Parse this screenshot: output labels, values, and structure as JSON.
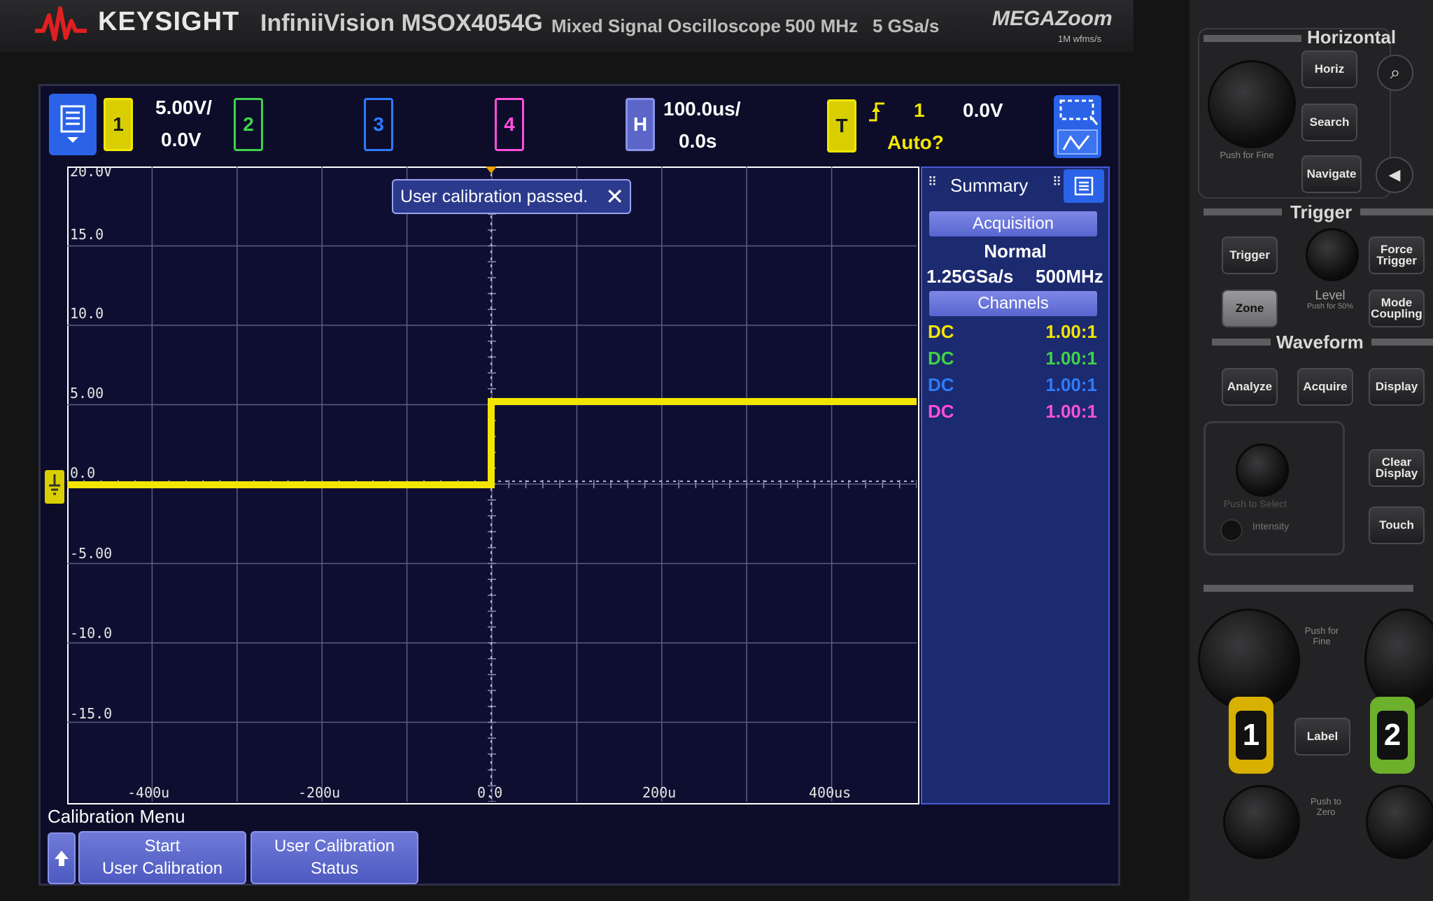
{
  "header": {
    "brand": "KEYSIGHT",
    "model": "InfiniiVision MSOX4054G",
    "description": "Mixed Signal Oscilloscope",
    "bandwidth": "500 MHz",
    "sample_rate": "5 GSa/s",
    "megazoom": "MEGAZoom",
    "megazoom_sub": "1M wfms/s"
  },
  "colors": {
    "ch1": "#f2e600",
    "ch2": "#3fd34a",
    "ch3": "#2d7bff",
    "ch4": "#ff4fdc",
    "screen_bg": "#0e0f30",
    "accent": "#4e5ac0"
  },
  "statusbar": {
    "ch1_label": "1",
    "ch1_scale": "5.00V/",
    "ch1_offset": "0.0V",
    "ch2_label": "2",
    "ch3_label": "3",
    "ch4_label": "4",
    "horiz_label": "H",
    "time_scale": "100.0us/",
    "time_delay": "0.0s",
    "trigger_label": "T",
    "trigger_source": "1",
    "trigger_mode": "Auto?",
    "trigger_level": "0.0V"
  },
  "notification": {
    "message": "User calibration passed."
  },
  "graticule": {
    "y_labels": [
      "20.0V",
      "15.0",
      "10.0",
      "5.00",
      "0.0",
      "-5.00",
      "-10.0",
      "-15.0"
    ],
    "x_labels": [
      "-400u",
      "-200u",
      "0.0",
      "200u",
      "400us"
    ]
  },
  "summary": {
    "title": "Summary",
    "acquisition_header": "Acquisition",
    "mode": "Normal",
    "sample_rate": "1.25GSa/s",
    "bandwidth": "500MHz",
    "channels_header": "Channels",
    "channels": [
      {
        "coupling": "DC",
        "probe": "1.00:1"
      },
      {
        "coupling": "DC",
        "probe": "1.00:1"
      },
      {
        "coupling": "DC",
        "probe": "1.00:1"
      },
      {
        "coupling": "DC",
        "probe": "1.00:1"
      }
    ]
  },
  "softkeys": {
    "menu_title": "Calibration Menu",
    "key1_line1": "Start",
    "key1_line2": "User Calibration",
    "key2_line1": "User Calibration",
    "key2_line2": "Status"
  },
  "front_panel": {
    "horizontal": "Horizontal",
    "horiz_btn": "Horiz",
    "search_btn": "Search",
    "navigate_btn": "Navigate",
    "trigger_section": "Trigger",
    "trigger_btn": "Trigger",
    "force_trigger_l1": "Force",
    "force_trigger_l2": "Trigger",
    "zone_btn": "Zone",
    "level_label": "Level",
    "level_sub": "Push for 50%",
    "mode_l1": "Mode",
    "mode_l2": "Coupling",
    "waveform_section": "Waveform",
    "analyze_btn": "Analyze",
    "acquire_btn": "Acquire",
    "display_btn": "Display",
    "push_to_select": "Push to Select",
    "intensity": "Intensity",
    "clear_l1": "Clear",
    "clear_l2": "Display",
    "touch_btn": "Touch",
    "push_for_fine": "Push for Fine",
    "label_btn": "Label",
    "push_to_zero": "Push to Zero",
    "ch1_key": "1",
    "ch2_key": "2",
    "push_fine_small": "Push for Fine"
  }
}
